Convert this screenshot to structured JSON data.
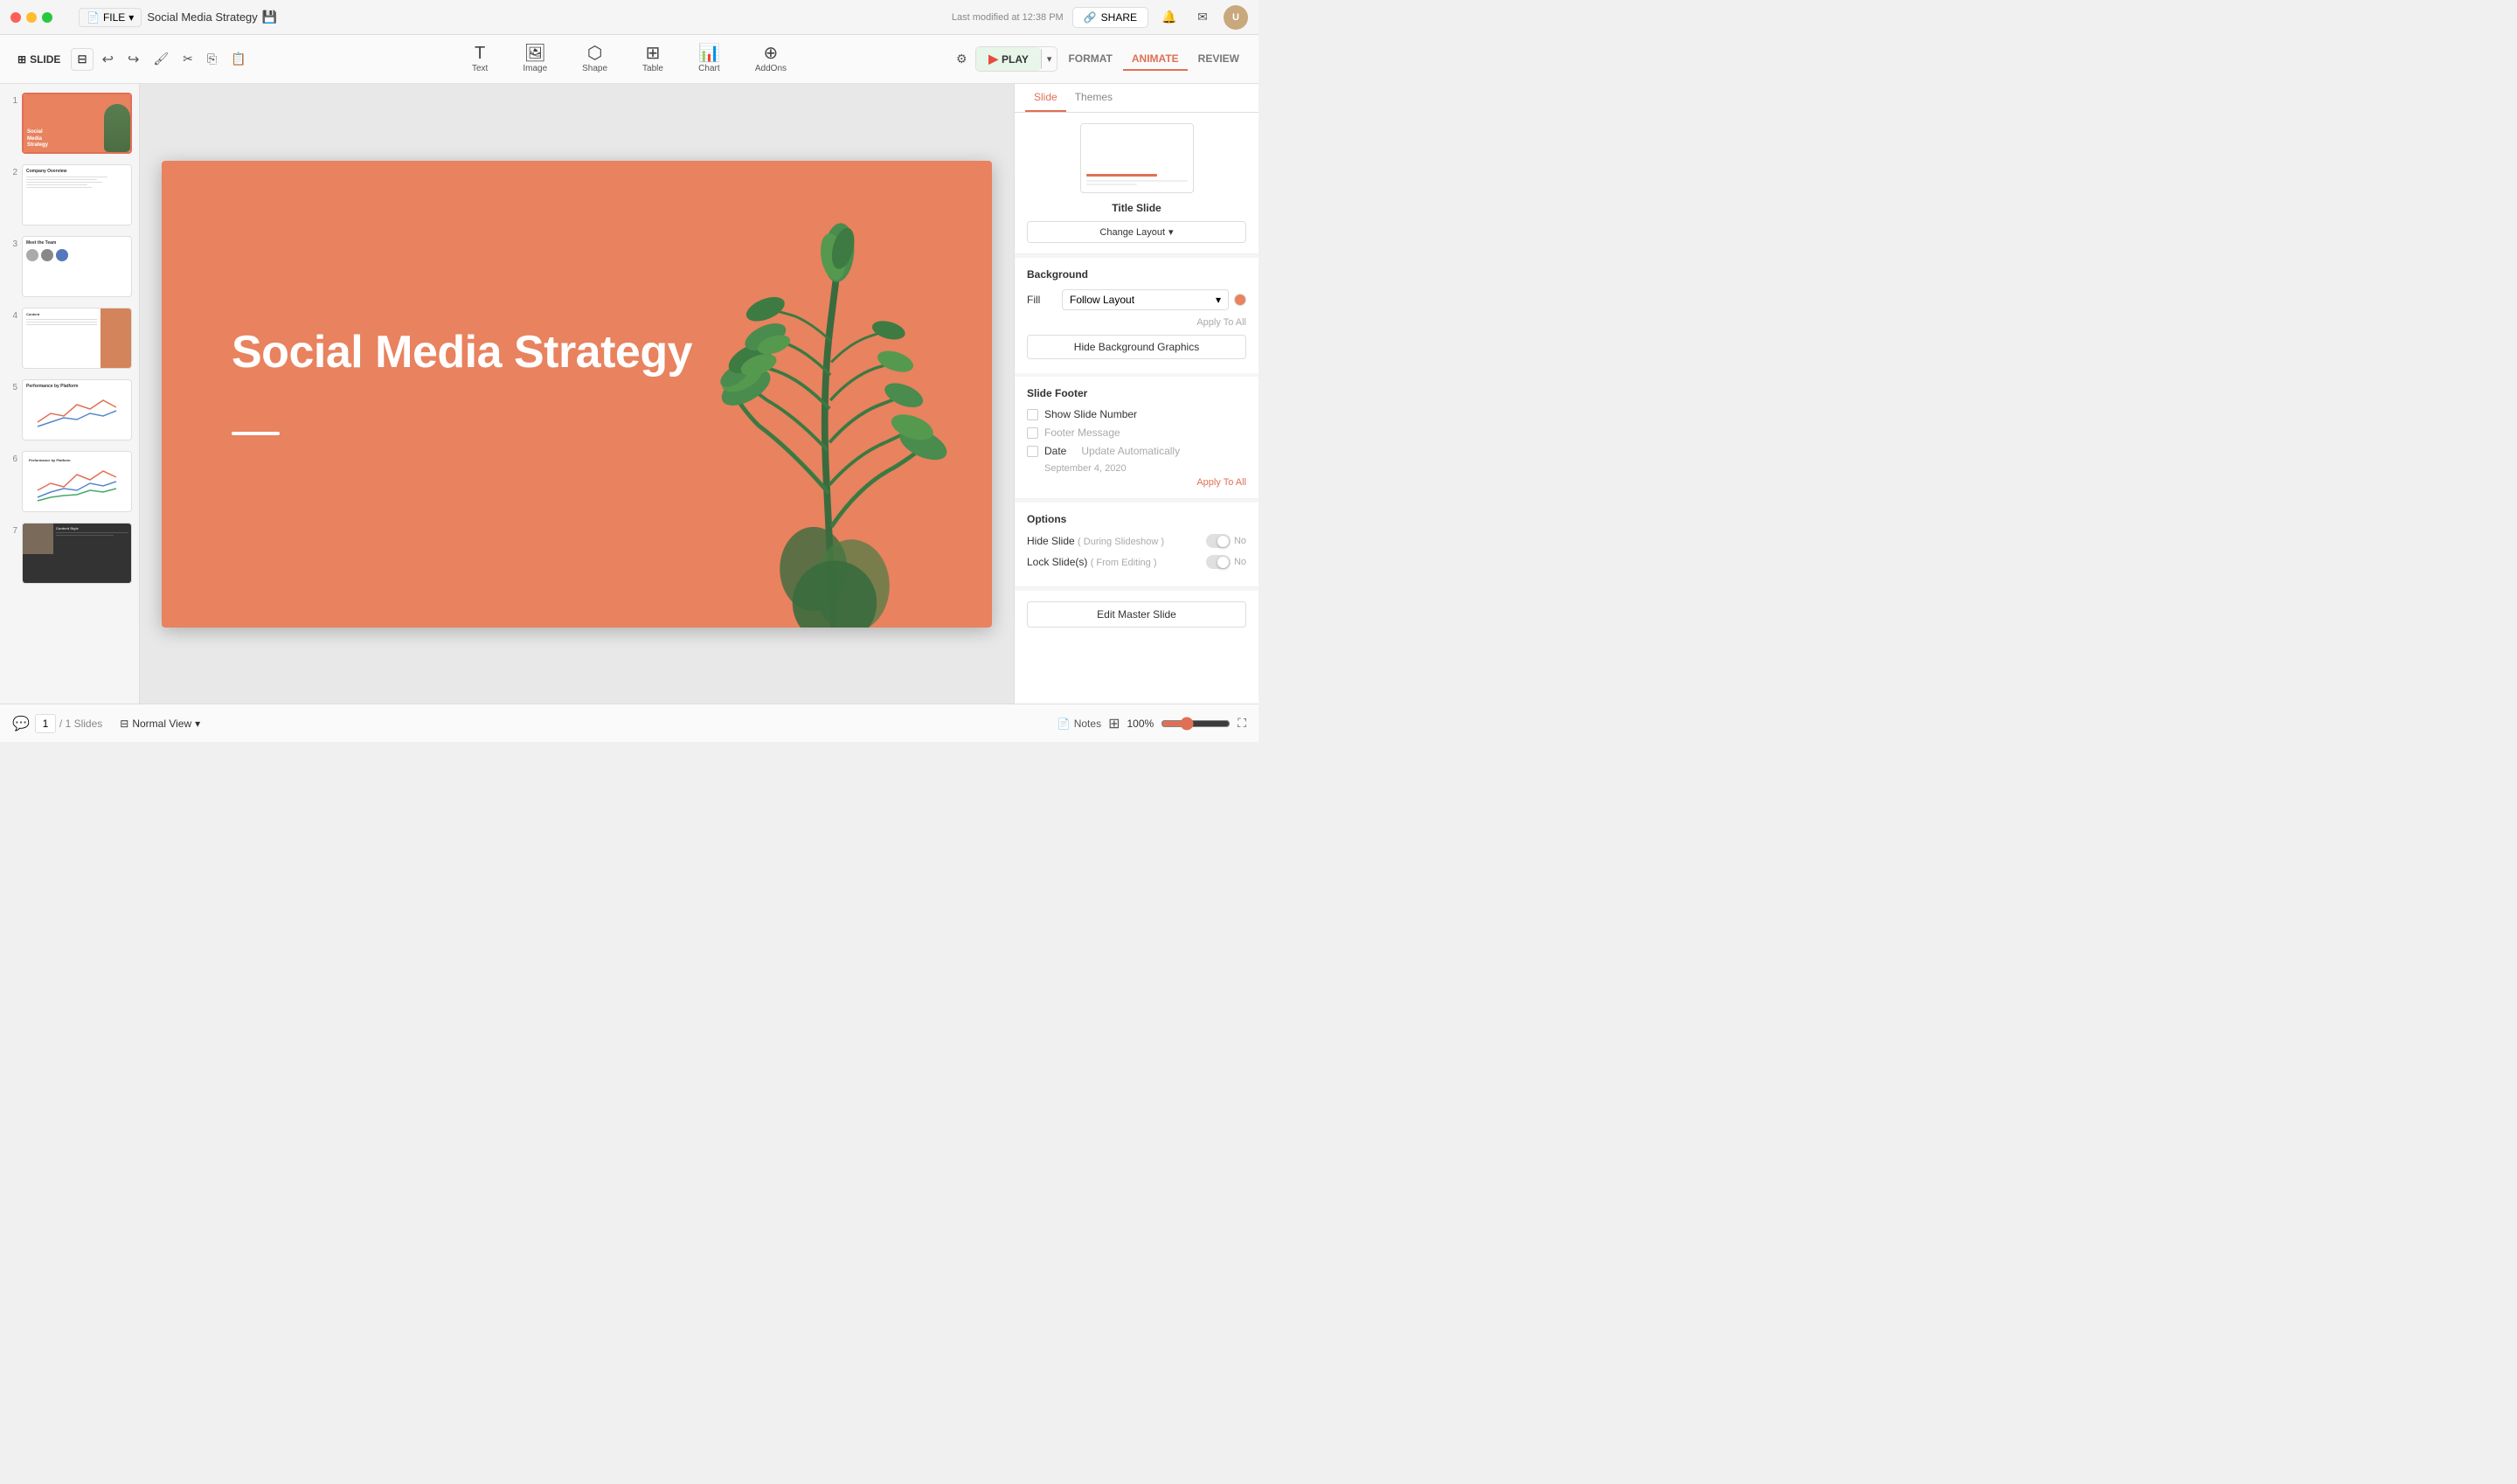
{
  "window": {
    "title": "Social Media Strategy"
  },
  "titlebar": {
    "file_label": "FILE",
    "doc_title": "Social Media Strategy",
    "last_modified": "Last modified at 12:38 PM",
    "share_label": "SHARE",
    "avatar_initials": "U"
  },
  "toolbar": {
    "slide_label": "SLIDE",
    "play_label": "PLAY",
    "format_label": "FORMAT",
    "animate_label": "ANIMATE",
    "review_label": "REVIEW",
    "tools": [
      {
        "id": "text",
        "label": "Text",
        "icon": "T"
      },
      {
        "id": "image",
        "label": "Image",
        "icon": "🖼"
      },
      {
        "id": "shape",
        "label": "Shape",
        "icon": "⬟"
      },
      {
        "id": "table",
        "label": "Table",
        "icon": "⊞"
      },
      {
        "id": "chart",
        "label": "Chart",
        "icon": "📊"
      },
      {
        "id": "addons",
        "label": "AddOns",
        "icon": "⊕"
      }
    ]
  },
  "slide_panel": {
    "slides": [
      {
        "number": 1,
        "type": "title"
      },
      {
        "number": 2,
        "type": "company"
      },
      {
        "number": 3,
        "type": "team"
      },
      {
        "number": 4,
        "type": "content"
      },
      {
        "number": 5,
        "type": "chart1"
      },
      {
        "number": 6,
        "type": "chart2"
      },
      {
        "number": 7,
        "type": "dark"
      }
    ]
  },
  "main_slide": {
    "title": "Social Media Strategy",
    "bg_color": "#e8825f"
  },
  "right_panel": {
    "tabs": [
      "Slide",
      "Themes"
    ],
    "active_tab": "Slide",
    "layout": {
      "title": "Title Slide",
      "change_layout_label": "Change Layout"
    },
    "background": {
      "section_title": "Background",
      "fill_label": "Fill",
      "fill_value": "Follow Layout",
      "apply_all_label": "Apply To All",
      "hide_bg_label": "Hide Background Graphics"
    },
    "footer": {
      "section_title": "Slide Footer",
      "show_slide_number": "Show Slide Number",
      "footer_message": "Footer Message",
      "date_label": "Date",
      "update_auto": "Update Automatically",
      "date_value": "September 4, 2020",
      "apply_all_label": "Apply To All"
    },
    "options": {
      "section_title": "Options",
      "hide_slide_label": "Hide Slide",
      "hide_slide_sub": "( During Slideshow )",
      "hide_slide_value": "No",
      "lock_slide_label": "Lock Slide(s)",
      "lock_slide_sub": "( From Editing )",
      "lock_slide_value": "No"
    },
    "edit_master_label": "Edit Master Slide"
  },
  "bottom_bar": {
    "slide_current": "1",
    "slide_total": "/ 1 Slides",
    "normal_view": "Normal View",
    "notes_label": "Notes",
    "zoom_level": "100%"
  }
}
